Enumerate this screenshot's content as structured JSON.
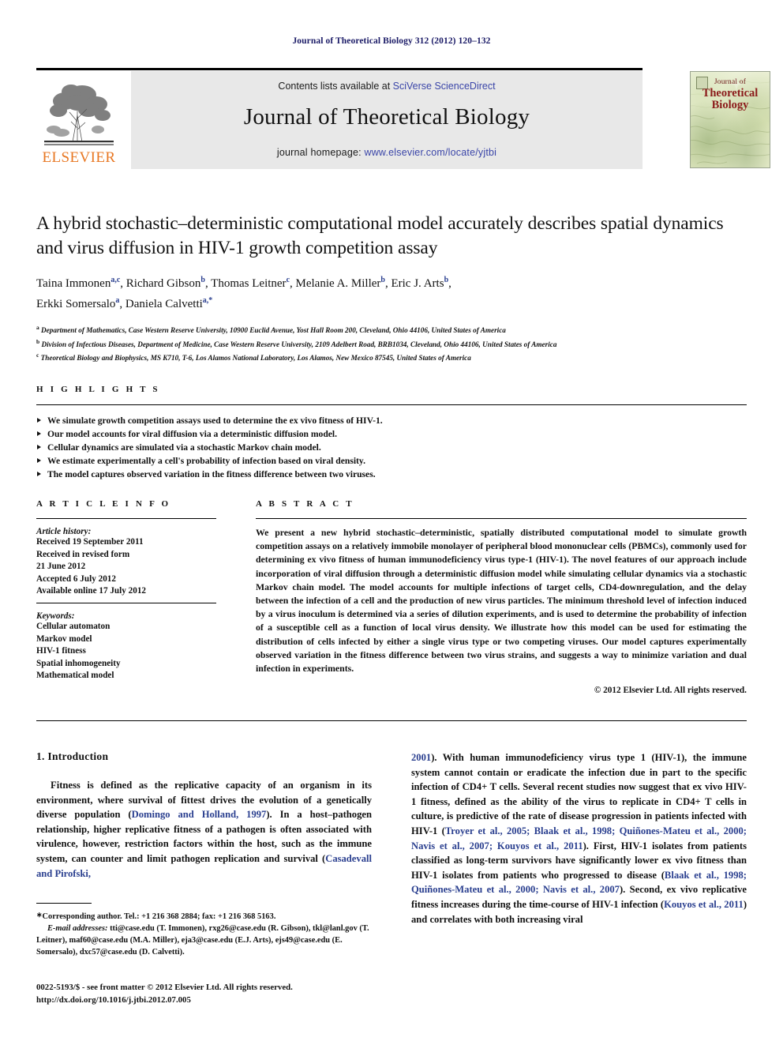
{
  "running_head": "Journal of Theoretical Biology 312 (2012) 120–132",
  "masthead": {
    "contents_prefix": "Contents lists available at ",
    "sciencedirect_link": "SciVerse ScienceDirect",
    "journal_title": "Journal of Theoretical Biology",
    "homepage_prefix": "journal homepage: ",
    "homepage_link": "www.elsevier.com/locate/yjtbi",
    "publisher_wordmark": "ELSEVIER",
    "cover": {
      "line1": "Journal of",
      "line2": "Theoretical",
      "line3": "Biology"
    },
    "link_color": "#3a45a8"
  },
  "article": {
    "title": "A hybrid stochastic–deterministic computational model accurately describes spatial dynamics and virus diffusion in HIV-1 growth competition assay",
    "authors_line1_parts": [
      {
        "name": "Taina Immonen",
        "sup": "a,c",
        "sep": ", "
      },
      {
        "name": "Richard Gibson",
        "sup": "b",
        "sep": ", "
      },
      {
        "name": "Thomas Leitner",
        "sup": "c",
        "sep": ", "
      },
      {
        "name": "Melanie A. Miller",
        "sup": "b",
        "sep": ", "
      },
      {
        "name": "Eric J. Arts",
        "sup": "b",
        "sep": ","
      }
    ],
    "authors_line2_parts": [
      {
        "name": "Erkki Somersalo",
        "sup": "a",
        "sep": ", "
      },
      {
        "name": "Daniela Calvetti",
        "sup": "a,*",
        "sep": ""
      }
    ],
    "affiliations": [
      {
        "marker": "a",
        "text": "Department of Mathematics, Case Western Reserve University, 10900 Euclid Avenue, Yost Hall Room 200, Cleveland, Ohio 44106, United States of America"
      },
      {
        "marker": "b",
        "text": "Division of Infectious Diseases, Department of Medicine, Case Western Reserve University, 2109 Adelbert Road, BRB1034, Cleveland, Ohio 44106, United States of America"
      },
      {
        "marker": "c",
        "text": "Theoretical Biology and Biophysics, MS K710, T-6, Los Alamos National Laboratory, Los Alamos, New Mexico 87545, United States of America"
      }
    ]
  },
  "highlights": {
    "heading": "H I G H L I G H T S",
    "items": [
      "We simulate growth competition assays used to determine the ex vivo fitness of HIV-1.",
      "Our model accounts for viral diffusion via a deterministic diffusion model.",
      "Cellular dynamics are simulated via a stochastic Markov chain model.",
      "We estimate experimentally a cell's probability of infection based on viral density.",
      "The model captures observed variation in the fitness difference between two viruses."
    ]
  },
  "article_info": {
    "heading": "A R T I C L E   I N F O",
    "history_label": "Article history:",
    "history_lines": [
      "Received 19 September 2011",
      "Received in revised form",
      "21 June 2012",
      "Accepted 6 July 2012",
      "Available online 17 July 2012"
    ],
    "keywords_label": "Keywords:",
    "keywords": [
      "Cellular automaton",
      "Markov model",
      "HIV-1 fitness",
      "Spatial inhomogeneity",
      "Mathematical model"
    ]
  },
  "abstract": {
    "heading": "A B S T R A C T",
    "body": "We present a new hybrid stochastic–deterministic, spatially distributed computational model to simulate growth competition assays on a relatively immobile monolayer of peripheral blood mononuclear cells (PBMCs), commonly used for determining ex vivo fitness of human immunodeficiency virus type-1 (HIV-1). The novel features of our approach include incorporation of viral diffusion through a deterministic diffusion model while simulating cellular dynamics via a stochastic Markov chain model. The model accounts for multiple infections of target cells, CD4-downregulation, and the delay between the infection of a cell and the production of new virus particles. The minimum threshold level of infection induced by a virus inoculum is determined via a series of dilution experiments, and is used to determine the probability of infection of a susceptible cell as a function of local virus density. We illustrate how this model can be used for estimating the distribution of cells infected by either a single virus type or two competing viruses. Our model captures experimentally observed variation in the fitness difference between two virus strains, and suggests a way to minimize variation and dual infection in experiments.",
    "copyright": "© 2012 Elsevier Ltd. All rights reserved."
  },
  "introduction": {
    "heading": "1.  Introduction",
    "left_p1_a": "Fitness is defined as the replicative capacity of an organism in its environment, where survival of fittest drives the evolution of a genetically diverse population (",
    "left_cite1": "Domingo and Holland, 1997",
    "left_p1_b": "). In a host–pathogen relationship, higher replicative fitness of a pathogen is often associated with virulence, however, restriction factors within the host, such as the immune system, can counter and limit pathogen replication and survival (",
    "left_cite2": "Casadevall and Pirofski,",
    "right_cite_cont": "2001",
    "right_p1_a": "). With human immunodeficiency virus type 1 (HIV-1), the immune system cannot contain or eradicate the infection due in part to the specific infection of CD4+ T cells. Several recent studies now suggest that ex vivo HIV-1 fitness, defined as the ability of the virus to replicate in CD4+ T cells in culture, is predictive of the rate of disease progression in patients infected with HIV-1 (",
    "right_cite_group1": "Troyer et al., 2005; Blaak et al., 1998; Quiñones-Mateu et al., 2000; Navis et al., 2007; Kouyos et al., 2011",
    "right_p1_b": "). First, HIV-1 isolates from patients classified as long-term survivors have significantly lower ex vivo fitness than HIV-1 isolates from patients who progressed to disease (",
    "right_cite_group2": "Blaak et al., 1998; Quiñones-Mateu et al., 2000; Navis et al., 2007",
    "right_p1_c": "). Second, ex vivo replicative fitness increases during the time-course of HIV-1 infection (",
    "right_cite_group3": "Kouyos et al., 2011",
    "right_p1_d": ") and correlates with both increasing viral"
  },
  "footnote": {
    "corresponding": "Corresponding author. Tel.: +1 216 368 2884; fax: +1 216 368 5163.",
    "email_label": "E-mail addresses:",
    "emails": "tti@case.edu (T. Immonen), rxg26@case.edu (R. Gibson), tkl@lanl.gov (T. Leitner), maf60@case.edu (M.A. Miller), eja3@case.edu (E.J. Arts), ejs49@case.edu (E. Somersalo), dxc57@case.edu (D. Calvetti)."
  },
  "imprint": {
    "line1": "0022-5193/$ - see front matter © 2012 Elsevier Ltd. All rights reserved.",
    "line2": "http://dx.doi.org/10.1016/j.jtbi.2012.07.005"
  }
}
